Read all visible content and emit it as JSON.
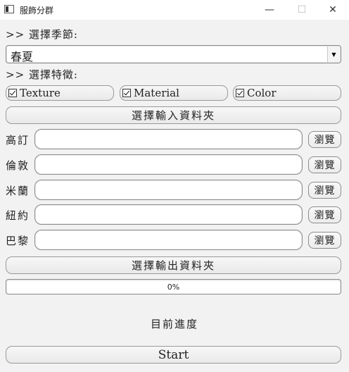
{
  "window": {
    "title": "服飾分群",
    "minimize": "—",
    "maximize": "☐",
    "close": "✕"
  },
  "season": {
    "label": ">> 選擇季節:",
    "selected": "春夏"
  },
  "features": {
    "label": ">> 選擇特徵:",
    "items": [
      {
        "label": "Texture",
        "checked": true
      },
      {
        "label": "Material",
        "checked": true
      },
      {
        "label": "Color",
        "checked": true
      }
    ]
  },
  "input_folder_button": "選擇輸入資料夾",
  "cities": [
    {
      "label": "高訂",
      "value": "",
      "browse": "瀏覽"
    },
    {
      "label": "倫敦",
      "value": "",
      "browse": "瀏覽"
    },
    {
      "label": "米蘭",
      "value": "",
      "browse": "瀏覽"
    },
    {
      "label": "紐約",
      "value": "",
      "browse": "瀏覽"
    },
    {
      "label": "巴黎",
      "value": "",
      "browse": "瀏覽"
    }
  ],
  "output_folder_button": "選擇輸出資料夾",
  "progress": {
    "value": 0,
    "text": "0%"
  },
  "status": "目前進度",
  "start_button": "Start",
  "colors": {
    "background": "#f2f2f2",
    "progress_fill": "#3c8de0"
  }
}
